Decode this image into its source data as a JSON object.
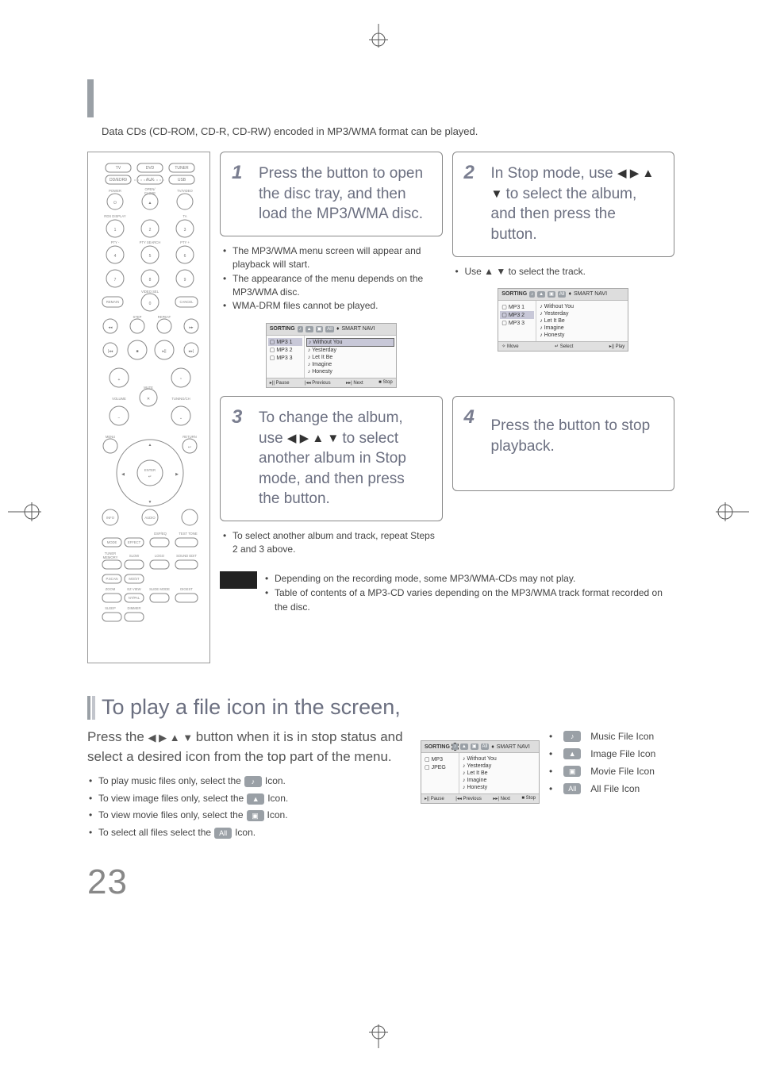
{
  "intro": "Data CDs (CD-ROM, CD-R, CD-RW) encoded in MP3/WMA format can be played.",
  "steps": {
    "s1": {
      "num": "1",
      "text_a": "Press the",
      "text_b": "button to open the disc tray, and then load the MP3/WMA disc.",
      "bullets": [
        "The MP3/WMA menu screen will appear and playback will start.",
        "The appearance of the menu depends on the MP3/WMA disc.",
        "WMA-DRM files cannot be played."
      ]
    },
    "s2": {
      "num": "2",
      "text_a": "In Stop mode, use",
      "text_b": "to select the album, and then press the",
      "text_c": "button.",
      "bullets": [
        "Use ▲ ▼ to select the track."
      ]
    },
    "s3": {
      "num": "3",
      "text_a": "To change the album, use",
      "text_b": "to select another album in Stop mode, and then press the",
      "text_c": "button.",
      "bullets": [
        "To select another album and track, repeat Steps 2 and 3 above."
      ]
    },
    "s4": {
      "num": "4",
      "text_a": "Press the",
      "text_b": "button to stop playback."
    }
  },
  "menu": {
    "sorting": "SORTING",
    "smart": "SMART NAVI",
    "folders": [
      "MP3 1",
      "MP3 2",
      "MP3 3"
    ],
    "tracks": [
      "Without You",
      "Yesterday",
      "Let It Be",
      "Imagine",
      "Honesty"
    ],
    "footer1": {
      "a": "Pause",
      "b": "Previous",
      "c": "Next",
      "d": "Stop"
    },
    "footer2": {
      "a": "Move",
      "b": "Select",
      "c": "Play"
    }
  },
  "notes": [
    "Depending on the recording mode, some MP3/WMA-CDs may not play.",
    "Table of contents of a MP3-CD varies depending on the MP3/WMA track format recorded on the disc."
  ],
  "sub": {
    "heading": "To play a file icon in the screen,",
    "lead_a": "Press the",
    "lead_b": "button when it is in stop status and select a desired icon from the top part of the menu.",
    "items": {
      "music": {
        "pre": "To play music files only, select the",
        "post": "Icon."
      },
      "image": {
        "pre": "To view image files only, select the",
        "post": "Icon."
      },
      "movie": {
        "pre": "To view movie files only, select the",
        "post": "Icon."
      },
      "all": {
        "pre": "To select all files select the",
        "post": "Icon."
      }
    },
    "legend": {
      "music": "Music File Icon",
      "image": "Image File Icon",
      "movie": "Movie File Icon",
      "all": "All File Icon"
    },
    "menu_folders": [
      "MP3",
      "JPEG"
    ]
  },
  "page_number": "23",
  "remote": {
    "row1": [
      "TV",
      "DVD",
      "TUNER"
    ],
    "row2": [
      "DD/EDR9",
      "AUX",
      "USB"
    ],
    "labels": {
      "power": "POWER",
      "openclose": "OPEN/\nCLOSE",
      "tvvideo": "TV/VIDEO",
      "rds": "RDS DISPLAY",
      "ta": "TA",
      "pty_minus": "PTY -",
      "pty_search": "PTY SEARCH",
      "pty_plus": "PTY +",
      "video_sel": "VIDEO SEL",
      "remain": "REMAIN",
      "cancel": "CANCEL",
      "step": "STEP",
      "repeat": "REPEAT",
      "mute": "MUTE",
      "volume": "VOLUME",
      "tuning": "TUNING/CH",
      "menu": "MENU",
      "return": "RETURN",
      "enter": "ENTER",
      "info": "INFO",
      "audio": "AUDIO",
      "mode": "MODE",
      "effect": "EFFECT",
      "dspeq": "DSP/EQ",
      "testtone": "TEST TONE",
      "tuner_mem": "TUNER\nMEMORY",
      "slow": "SLOW",
      "logo": "LOGO",
      "soundedit": "SOUND EDIT",
      "pscan": "P.SCAN",
      "most": "MO/ST",
      "zoom": "ZOOM",
      "ezview": "EZ VIEW",
      "slidemode": "SLIDE MODE",
      "digest": "DIGEST",
      "sleep": "SLEEP",
      "ntpal": "NT/PAL",
      "dimmer": "DIMMER"
    }
  }
}
